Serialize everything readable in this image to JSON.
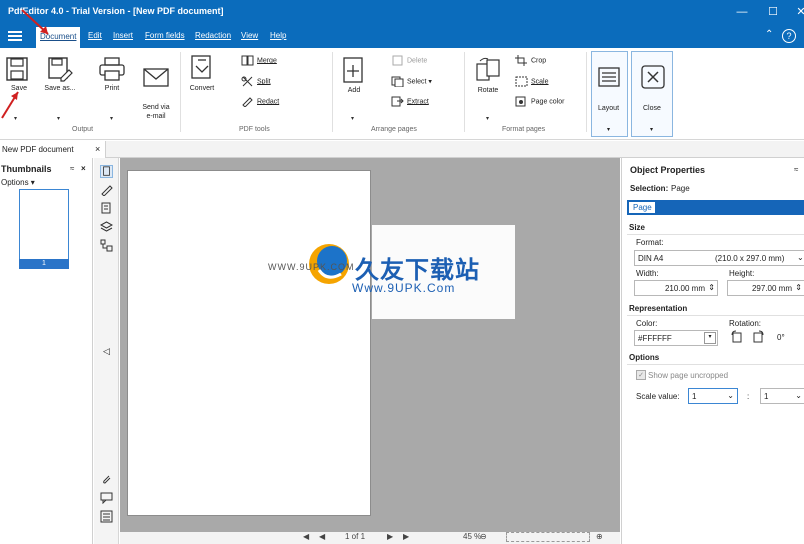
{
  "titlebar": {
    "title": "PdfEditor 4.0 - Trial Version - [New PDF document]",
    "minimize": "—",
    "maximize": "☐",
    "close": "✕"
  },
  "menu": {
    "tabs": [
      "Document",
      "Edit",
      "Insert",
      "Form fields",
      "Redaction",
      "View",
      "Help"
    ],
    "active": "Document",
    "collapse": "⌃",
    "help": "?"
  },
  "ribbon": {
    "save": "Save",
    "save_as": "Save as...",
    "print": "Print",
    "send_email": "Send via\ne-mail",
    "convert": "Convert",
    "merge": "Merge",
    "split": "Split",
    "redact": "Redact",
    "add": "Add",
    "delete": "Delete",
    "select": "Select",
    "extract": "Extract",
    "rotate": "Rotate",
    "crop": "Crop",
    "scale": "Scale",
    "page_color": "Page color",
    "layout": "Layout",
    "close": "Close",
    "groups": {
      "output": "Output",
      "pdf_tools": "PDF tools",
      "arrange_pages": "Arrange pages",
      "format_pages": "Format pages"
    }
  },
  "doc_tab": {
    "label": "New PDF document",
    "close": "×"
  },
  "thumbnails": {
    "title": "Thumbnails",
    "options": "Options",
    "page_number": "1"
  },
  "watermark": {
    "cn": "久友下载站",
    "left": "WWW.9UPK.COM",
    "url": "Www.9UPK.Com"
  },
  "navbar": {
    "page": "1 of 1",
    "zoom": "45 %"
  },
  "properties": {
    "title": "Object Properties",
    "selection_label": "Selection:",
    "selection_value": "Page",
    "tab": "Page",
    "size_section": "Size",
    "format_label": "Format:",
    "format_value": "DIN A4",
    "format_dims": "(210.0 x 297.0 mm)",
    "width_label": "Width:",
    "width_value": "210.00 mm",
    "height_label": "Height:",
    "height_value": "297.00 mm",
    "representation_section": "Representation",
    "color_label": "Color:",
    "color_value": "#FFFFFF",
    "rotation_label": "Rotation:",
    "rotation_value": "0°",
    "options_section": "Options",
    "show_uncropped": "Show page uncropped",
    "scale_label": "Scale value:",
    "scale_a": "1",
    "scale_sep": ":",
    "scale_b": "1"
  },
  "colors": {
    "brand": "#0b6cbc",
    "canvas": "#a9a9a9",
    "arrow": "#d02020"
  }
}
